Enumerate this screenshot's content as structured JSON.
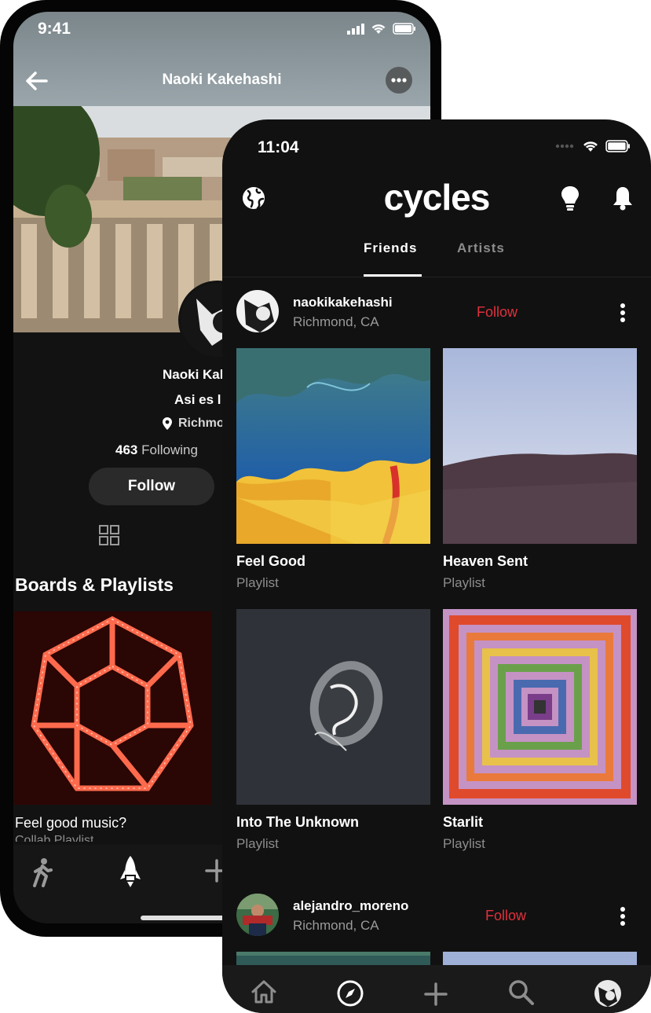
{
  "back_phone": {
    "time": "9:41",
    "title": "Naoki Kakehashi",
    "profile_name": "Naoki Kal",
    "profile_bio": "Asi es l",
    "profile_location": "Richmo",
    "following_count": "463",
    "following_label": "Following",
    "follow_label": "Follow",
    "section_title": "Boards & Playlists",
    "playlist_title": "Feel good music?",
    "playlist_subtitle": "Collab Playlist"
  },
  "front_phone": {
    "time": "11:04",
    "app_logo": "cycles",
    "tabs": [
      "Friends",
      "Artists"
    ],
    "active_tab": "Friends",
    "posts": [
      {
        "username": "naokikakehashi",
        "location": "Richmond, CA",
        "follow_label": "Follow",
        "items": [
          {
            "title": "Feel Good",
            "type": "Playlist"
          },
          {
            "title": "Heaven Sent",
            "type": "Playlist"
          },
          {
            "title": "Into The Unknown",
            "type": "Playlist"
          },
          {
            "title": "Starlit",
            "type": "Playlist"
          }
        ]
      },
      {
        "username": "alejandro_moreno",
        "location": "Richmond, CA",
        "follow_label": "Follow"
      }
    ],
    "nav_items": [
      "home-icon",
      "explore-compass-icon",
      "add-icon",
      "search-icon",
      "profile-avatar"
    ]
  },
  "colors": {
    "background": "#ffffff",
    "screen_dark": "#111111",
    "follow_accent": "#e0313d",
    "muted_text": "#8d8d8d"
  }
}
